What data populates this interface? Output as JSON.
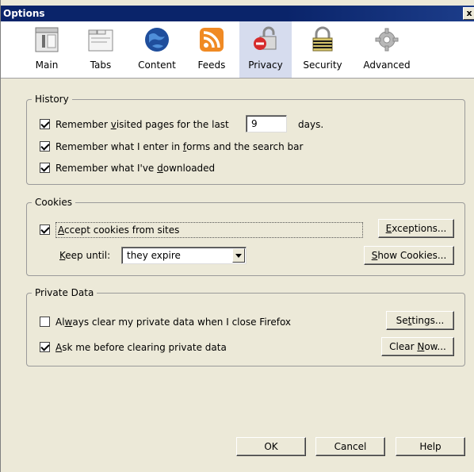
{
  "window": {
    "title": "Options",
    "close_glyph": "x"
  },
  "toolbar": {
    "items": [
      {
        "label": "Main",
        "icon": "main-icon"
      },
      {
        "label": "Tabs",
        "icon": "tabs-icon"
      },
      {
        "label": "Content",
        "icon": "content-icon"
      },
      {
        "label": "Feeds",
        "icon": "feeds-icon"
      },
      {
        "label": "Privacy",
        "icon": "privacy-icon",
        "selected": true
      },
      {
        "label": "Security",
        "icon": "security-icon"
      },
      {
        "label": "Advanced",
        "icon": "advanced-icon"
      }
    ]
  },
  "history": {
    "legend": "History",
    "visited_pre": "Remember ",
    "visited_ul": "v",
    "visited_post": "isited pages for the last",
    "days_value": "9",
    "days_label": "days.",
    "forms_pre": "Remember what I enter in ",
    "forms_ul": "f",
    "forms_post": "orms and the search bar",
    "downloads_pre": "Remember what I've ",
    "downloads_ul": "d",
    "downloads_post": "ownloaded"
  },
  "cookies": {
    "legend": "Cookies",
    "accept_ul": "A",
    "accept_post": "ccept cookies from sites",
    "exceptions_ul": "E",
    "exceptions_post": "xceptions...",
    "keep_ul": "K",
    "keep_post": "eep until:",
    "keep_value": "they expire",
    "show_ul": "S",
    "show_post": "how Cookies..."
  },
  "private_data": {
    "legend": "Private Data",
    "always_pre": "Al",
    "always_ul": "w",
    "always_post": "ays clear my private data when I close Firefox",
    "settings_pre": "Se",
    "settings_ul": "t",
    "settings_post": "tings...",
    "ask_ul": "A",
    "ask_post": "sk me before clearing private data",
    "clear_pre": "Clear ",
    "clear_ul": "N",
    "clear_post": "ow..."
  },
  "footer": {
    "ok": "OK",
    "cancel": "Cancel",
    "help": "Help"
  },
  "colors": {
    "title_bar": "#0a246a",
    "selected_tab": "#d6dcee",
    "dialog_bg": "#ece9d8"
  }
}
